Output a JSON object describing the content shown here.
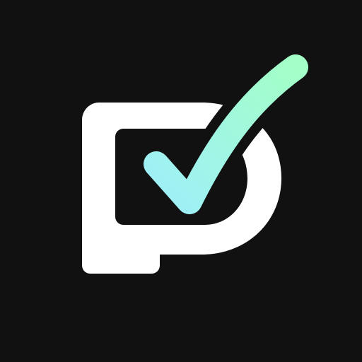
{
  "app_icon": {
    "background_color": "#111111",
    "letter_color": "#FFFFFF",
    "check_gradient": {
      "start": "#9EEFF8",
      "end": "#A3FFC7"
    },
    "icons": {
      "logo": "p-letter-icon",
      "check": "check-mark-icon"
    }
  }
}
